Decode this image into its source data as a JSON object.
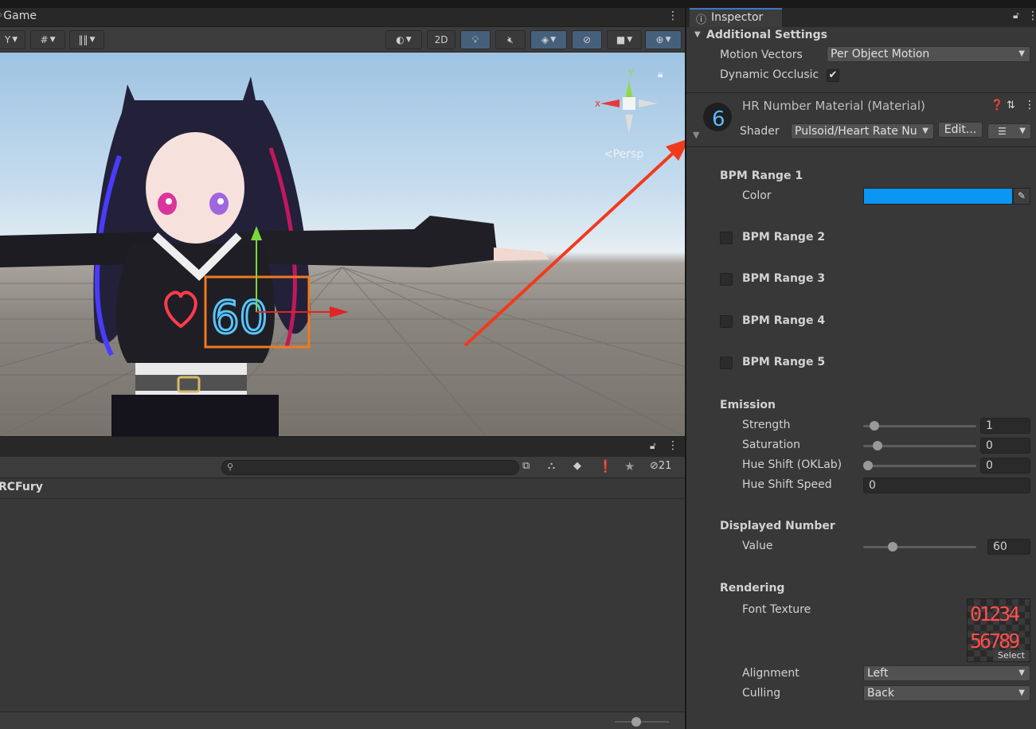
{
  "scene": {
    "tab_label": "Game",
    "toolbar": {
      "mode_2d_label": "2D",
      "persp_label": "Persp",
      "gizmo_axes": {
        "x": "x",
        "y": "y"
      }
    },
    "heart_number_text": "60"
  },
  "lower_panel": {
    "row_label": "RCFury",
    "search_placeholder": "",
    "hidden_count": "21"
  },
  "inspector": {
    "tab_label": "Inspector",
    "additional_settings": {
      "header": "Additional Settings",
      "motion_vectors_label": "Motion Vectors",
      "motion_vectors_value": "Per Object Motion",
      "dynamic_occlusion_label": "Dynamic Occlusic",
      "dynamic_occlusion_checked": true
    },
    "material": {
      "name": "HR Number Material (Material)",
      "shader_label": "Shader",
      "shader_value": "Pulsoid/Heart Rate Nu",
      "edit_label": "Edit..."
    },
    "bpm_range_1": {
      "header": "BPM Range 1",
      "color_label": "Color",
      "color_value": "#0a96f2"
    },
    "bpm_ranges": [
      {
        "label": "BPM Range 2",
        "checked": false
      },
      {
        "label": "BPM Range 3",
        "checked": false
      },
      {
        "label": "BPM Range 4",
        "checked": false
      },
      {
        "label": "BPM Range 5",
        "checked": false
      }
    ],
    "emission": {
      "header": "Emission",
      "strength_label": "Strength",
      "strength_value": "1",
      "saturation_label": "Saturation",
      "saturation_value": "0",
      "hue_shift_label": "Hue Shift (OKLab)",
      "hue_shift_value": "0",
      "hue_speed_label": "Hue Shift Speed",
      "hue_speed_value": "0"
    },
    "displayed_number": {
      "header": "Displayed Number",
      "value_label": "Value",
      "value": "60"
    },
    "rendering": {
      "header": "Rendering",
      "font_texture_label": "Font Texture",
      "font_texture_row1": "01234",
      "font_texture_row2": "56789",
      "select_label": "Select",
      "alignment_label": "Alignment",
      "alignment_value": "Left",
      "culling_label": "Culling",
      "culling_value": "Back"
    }
  },
  "colors": {
    "accent_arrow": "#f03a1e",
    "selection_box": "#f07a1e",
    "color_swatch": "#0a96f2"
  }
}
